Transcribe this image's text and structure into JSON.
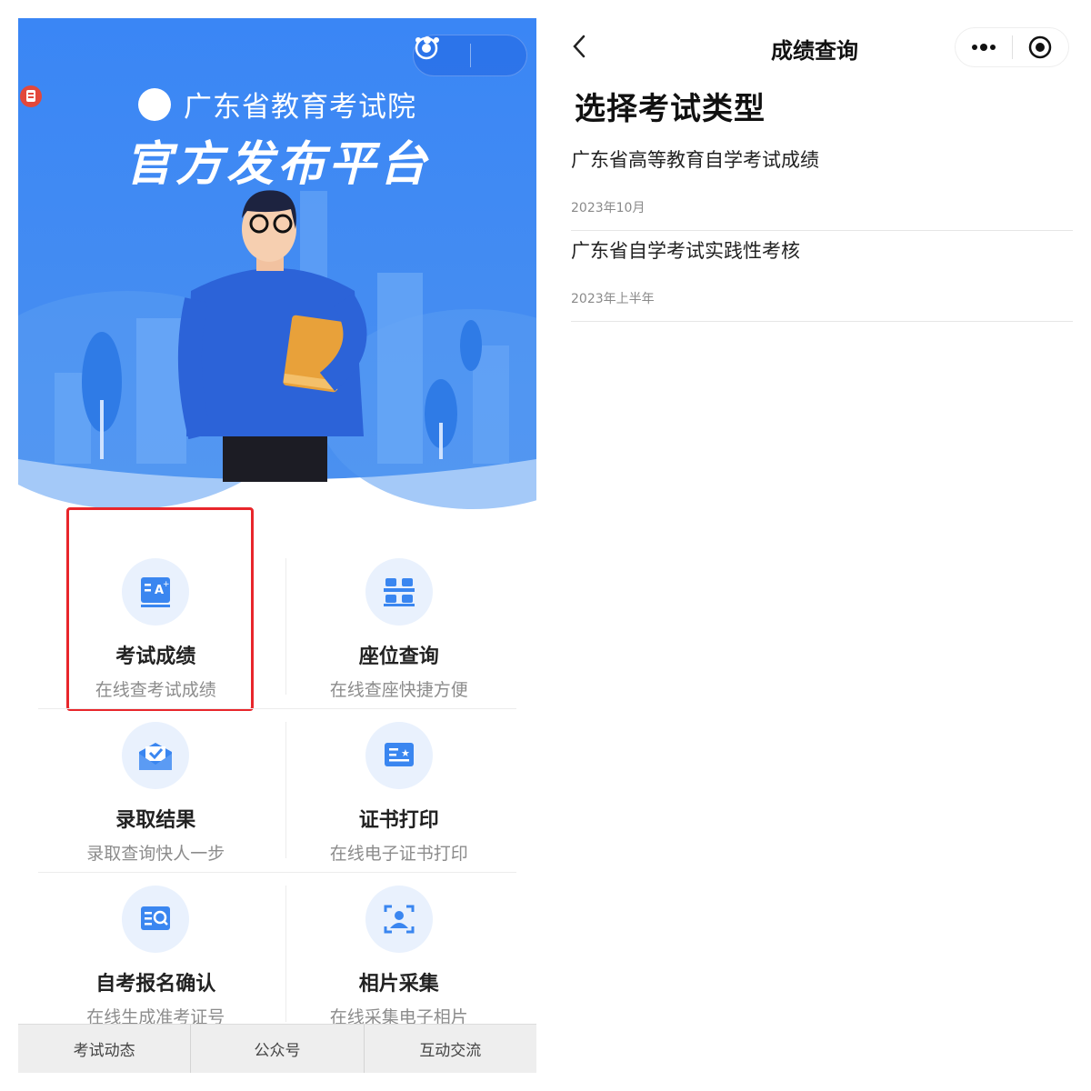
{
  "left": {
    "hero": {
      "org_name": "广东省教育考试院",
      "platform_title": "官方发布平台"
    },
    "capsule": {
      "more_icon": "more-dots-icon",
      "close_icon": "target-circle-icon"
    },
    "services": [
      {
        "title": "考试成绩",
        "subtitle": "在线查考试成绩",
        "icon": "score-a-plus-icon"
      },
      {
        "title": "座位查询",
        "subtitle": "在线查座快捷方便",
        "icon": "seats-icon"
      },
      {
        "title": "录取结果",
        "subtitle": "录取查询快人一步",
        "icon": "envelope-check-icon"
      },
      {
        "title": "证书打印",
        "subtitle": "在线电子证书打印",
        "icon": "certificate-icon"
      },
      {
        "title": "自考报名确认",
        "subtitle": "在线生成准考证号",
        "icon": "search-document-icon"
      },
      {
        "title": "相片采集",
        "subtitle": "在线采集电子相片",
        "icon": "photo-capture-icon"
      }
    ],
    "bottom_tabs": [
      "考试动态",
      "公众号",
      "互动交流"
    ],
    "colors": {
      "hero_blue": "#3d8af7",
      "icon_blue": "#3a86f0",
      "highlight": "#e8262b"
    }
  },
  "right": {
    "nav_title": "成绩查询",
    "heading": "选择考试类型",
    "exams": [
      {
        "name": "广东省高等教育自学考试成绩",
        "date": "2023年10月"
      },
      {
        "name": "广东省自学考试实践性考核",
        "date": "2023年上半年"
      }
    ]
  }
}
